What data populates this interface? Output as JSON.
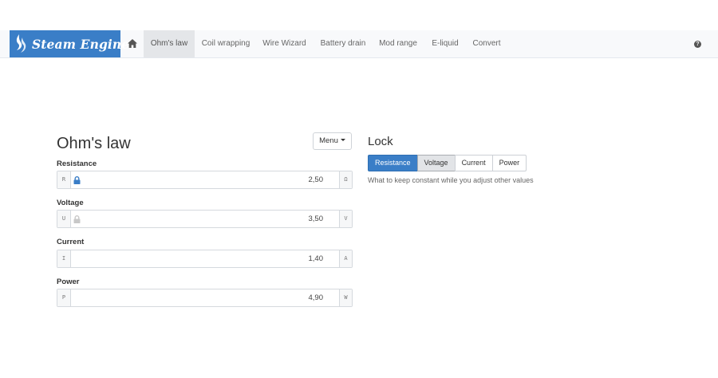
{
  "navbar": {
    "brand": "Steam Engine",
    "items": [
      "Ohm's law",
      "Coil wrapping",
      "Wire Wizard",
      "Battery drain",
      "Mod range",
      "E-liquid",
      "Convert"
    ],
    "active": "Ohm's law",
    "help_symbol": "?"
  },
  "calculator": {
    "title": "Ohm's law",
    "menu_label": "Menu",
    "fields": [
      {
        "label": "Resistance",
        "symbol": "R",
        "unit": "Ω",
        "value": "2,50",
        "lock_icon": "lock-icon",
        "locked": true
      },
      {
        "label": "Voltage",
        "symbol": "U",
        "unit": "V",
        "value": "3,50",
        "lock_icon": "lock-icon",
        "locked": false
      },
      {
        "label": "Current",
        "symbol": "I",
        "unit": "A",
        "value": "1,40"
      },
      {
        "label": "Power",
        "symbol": "P",
        "unit": "W",
        "value": "4,90"
      }
    ]
  },
  "lock_panel": {
    "title": "Lock",
    "options": [
      "Resistance",
      "Voltage",
      "Current",
      "Power"
    ],
    "selected": "Resistance",
    "hint": "What to keep constant while you adjust other values"
  },
  "colors": {
    "brand": "#3a7ec7",
    "active_nav": "#e4e6e9",
    "locked_icon": "#3a7ec7",
    "unlocked_icon": "#c8c8c8"
  }
}
